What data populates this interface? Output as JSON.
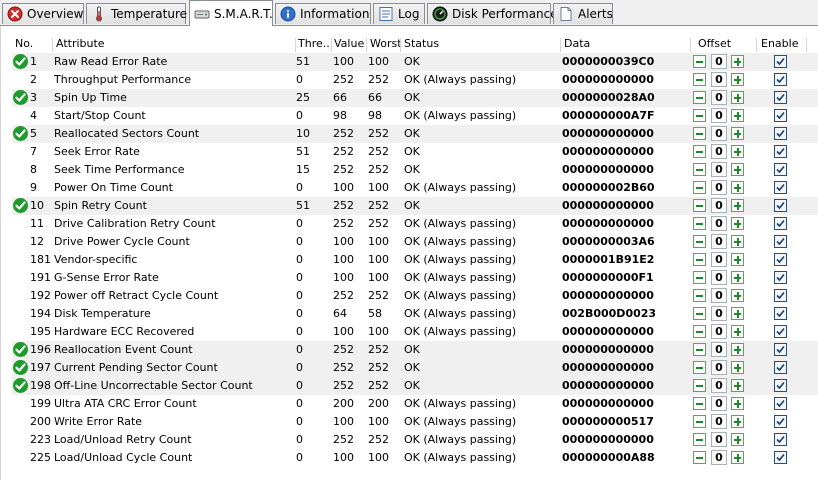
{
  "tabs": [
    {
      "label": "Overview",
      "icon": "red-x-icon"
    },
    {
      "label": "Temperature",
      "icon": "thermometer-icon"
    },
    {
      "label": "S.M.A.R.T.",
      "icon": "hard-drive-icon",
      "active": true
    },
    {
      "label": "Information",
      "icon": "info-icon"
    },
    {
      "label": "Log",
      "icon": "log-icon"
    },
    {
      "label": "Disk Performance",
      "icon": "gauge-icon"
    },
    {
      "label": "Alerts",
      "icon": "document-icon"
    }
  ],
  "columns": {
    "no": "No.",
    "attribute": "Attribute",
    "threshold": "Thre...",
    "value": "Value",
    "worst": "Worst",
    "status": "Status",
    "data": "Data",
    "offset": "Offset",
    "enable": "Enable"
  },
  "colors": {
    "ok_green": "#1f9b2e",
    "offset_green": "#1a8a2a",
    "alt_row": "#f0f0f0"
  },
  "rows": [
    {
      "no": "1",
      "attribute": "Raw Read Error Rate",
      "threshold": "51",
      "value": "100",
      "worst": "100",
      "status": "OK",
      "data": "0000000039C0",
      "offset": "0",
      "enabled": true,
      "ok_icon": true
    },
    {
      "no": "2",
      "attribute": "Throughput Performance",
      "threshold": "0",
      "value": "252",
      "worst": "252",
      "status": "OK (Always passing)",
      "data": "000000000000",
      "offset": "0",
      "enabled": true,
      "ok_icon": false
    },
    {
      "no": "3",
      "attribute": "Spin Up Time",
      "threshold": "25",
      "value": "66",
      "worst": "66",
      "status": "OK",
      "data": "0000000028A0",
      "offset": "0",
      "enabled": true,
      "ok_icon": true
    },
    {
      "no": "4",
      "attribute": "Start/Stop Count",
      "threshold": "0",
      "value": "98",
      "worst": "98",
      "status": "OK (Always passing)",
      "data": "000000000A7F",
      "offset": "0",
      "enabled": true,
      "ok_icon": false
    },
    {
      "no": "5",
      "attribute": "Reallocated Sectors Count",
      "threshold": "10",
      "value": "252",
      "worst": "252",
      "status": "OK",
      "data": "000000000000",
      "offset": "0",
      "enabled": true,
      "ok_icon": true
    },
    {
      "no": "7",
      "attribute": "Seek Error Rate",
      "threshold": "51",
      "value": "252",
      "worst": "252",
      "status": "OK",
      "data": "000000000000",
      "offset": "0",
      "enabled": true,
      "ok_icon": false
    },
    {
      "no": "8",
      "attribute": "Seek Time Performance",
      "threshold": "15",
      "value": "252",
      "worst": "252",
      "status": "OK",
      "data": "000000000000",
      "offset": "0",
      "enabled": true,
      "ok_icon": false
    },
    {
      "no": "9",
      "attribute": "Power On Time Count",
      "threshold": "0",
      "value": "100",
      "worst": "100",
      "status": "OK (Always passing)",
      "data": "000000002B60",
      "offset": "0",
      "enabled": true,
      "ok_icon": false
    },
    {
      "no": "10",
      "attribute": "Spin Retry Count",
      "threshold": "51",
      "value": "252",
      "worst": "252",
      "status": "OK",
      "data": "000000000000",
      "offset": "0",
      "enabled": true,
      "ok_icon": true
    },
    {
      "no": "11",
      "attribute": "Drive Calibration Retry Count",
      "threshold": "0",
      "value": "252",
      "worst": "252",
      "status": "OK (Always passing)",
      "data": "000000000000",
      "offset": "0",
      "enabled": true,
      "ok_icon": false
    },
    {
      "no": "12",
      "attribute": "Drive Power Cycle Count",
      "threshold": "0",
      "value": "100",
      "worst": "100",
      "status": "OK (Always passing)",
      "data": "0000000003A6",
      "offset": "0",
      "enabled": true,
      "ok_icon": false
    },
    {
      "no": "181",
      "attribute": "Vendor-specific",
      "threshold": "0",
      "value": "100",
      "worst": "100",
      "status": "OK (Always passing)",
      "data": "0000001B91E2",
      "offset": "0",
      "enabled": true,
      "ok_icon": false
    },
    {
      "no": "191",
      "attribute": "G-Sense Error Rate",
      "threshold": "0",
      "value": "100",
      "worst": "100",
      "status": "OK (Always passing)",
      "data": "0000000000F1",
      "offset": "0",
      "enabled": true,
      "ok_icon": false
    },
    {
      "no": "192",
      "attribute": "Power off Retract Cycle Count",
      "threshold": "0",
      "value": "252",
      "worst": "252",
      "status": "OK (Always passing)",
      "data": "000000000000",
      "offset": "0",
      "enabled": true,
      "ok_icon": false
    },
    {
      "no": "194",
      "attribute": "Disk Temperature",
      "threshold": "0",
      "value": "64",
      "worst": "58",
      "status": "OK (Always passing)",
      "data": "002B000D0023",
      "offset": "0",
      "enabled": true,
      "ok_icon": false
    },
    {
      "no": "195",
      "attribute": "Hardware ECC Recovered",
      "threshold": "0",
      "value": "100",
      "worst": "100",
      "status": "OK (Always passing)",
      "data": "000000000000",
      "offset": "0",
      "enabled": true,
      "ok_icon": false
    },
    {
      "no": "196",
      "attribute": "Reallocation Event Count",
      "threshold": "0",
      "value": "252",
      "worst": "252",
      "status": "OK",
      "data": "000000000000",
      "offset": "0",
      "enabled": true,
      "ok_icon": true
    },
    {
      "no": "197",
      "attribute": "Current Pending Sector Count",
      "threshold": "0",
      "value": "252",
      "worst": "252",
      "status": "OK",
      "data": "000000000000",
      "offset": "0",
      "enabled": true,
      "ok_icon": true
    },
    {
      "no": "198",
      "attribute": "Off-Line Uncorrectable Sector Count",
      "threshold": "0",
      "value": "252",
      "worst": "252",
      "status": "OK",
      "data": "000000000000",
      "offset": "0",
      "enabled": true,
      "ok_icon": true
    },
    {
      "no": "199",
      "attribute": "Ultra ATA CRC Error Count",
      "threshold": "0",
      "value": "200",
      "worst": "200",
      "status": "OK (Always passing)",
      "data": "000000000000",
      "offset": "0",
      "enabled": true,
      "ok_icon": false
    },
    {
      "no": "200",
      "attribute": "Write Error Rate",
      "threshold": "0",
      "value": "100",
      "worst": "100",
      "status": "OK (Always passing)",
      "data": "000000000517",
      "offset": "0",
      "enabled": true,
      "ok_icon": false
    },
    {
      "no": "223",
      "attribute": "Load/Unload Retry Count",
      "threshold": "0",
      "value": "252",
      "worst": "252",
      "status": "OK (Always passing)",
      "data": "000000000000",
      "offset": "0",
      "enabled": true,
      "ok_icon": false
    },
    {
      "no": "225",
      "attribute": "Load/Unload Cycle Count",
      "threshold": "0",
      "value": "100",
      "worst": "100",
      "status": "OK (Always passing)",
      "data": "000000000A88",
      "offset": "0",
      "enabled": true,
      "ok_icon": false
    }
  ]
}
